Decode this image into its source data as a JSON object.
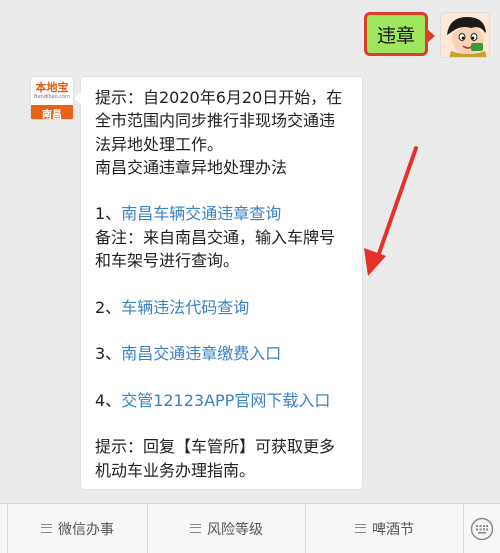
{
  "outgoing": {
    "text": "违章"
  },
  "bot": {
    "logo_main": "本地宝",
    "logo_sub": "Bendibao.com",
    "logo_city": "南昌"
  },
  "reply": {
    "intro": "提示：自2020年6月20日开始，在全市范围内同步推行非现场交通违法异地处理工作。",
    "heading": "南昌交通违章异地处理办法",
    "item1_num": "1、",
    "item1_link": "南昌车辆交通违章查询",
    "item1_note": "备注：来自南昌交通，输入车牌号和车架号进行查询。",
    "item2_num": "2、",
    "item2_link": "车辆违法代码查询",
    "item3_num": "3、",
    "item3_link": "南昌交通违章缴费入口",
    "item4_num": "4、",
    "item4_link": "交管12123APP官网下载入口",
    "tip": "提示：回复【车管所】可获取更多机动车业务办理指南。"
  },
  "menu": {
    "items": [
      "微信办事",
      "风险等级",
      "啤酒节"
    ]
  },
  "colors": {
    "link": "#3b82c4",
    "outgoing_bubble": "#9ee65e",
    "highlight_border": "#e13b2e",
    "arrow": "#e4322b"
  },
  "icons": {
    "user_avatar": "cartoon-boy-avatar",
    "menu": "hamburger-icon",
    "keyboard": "keyboard-icon"
  }
}
